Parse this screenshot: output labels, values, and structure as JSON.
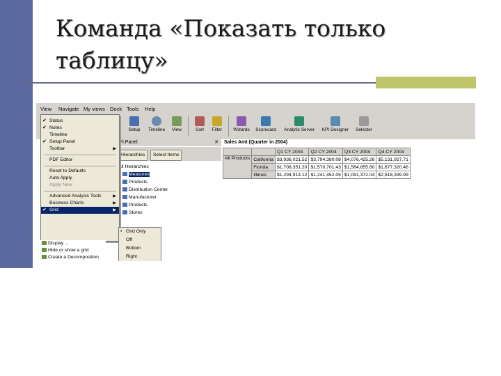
{
  "slide": {
    "title_line1": "Команда «Показать только",
    "title_line2": "таблицу»"
  },
  "menubar": [
    "View",
    "Navigate",
    "My views",
    "Dock",
    "Tools",
    "Help"
  ],
  "toolbar": {
    "buttons": [
      "Setup",
      "Timeline",
      "View",
      "Sort",
      "Filter",
      "Wizards",
      "Scorecard",
      "Analytic Server",
      "KPI Designer",
      "Selector"
    ]
  },
  "view_menu": {
    "items": [
      {
        "label": "Status",
        "checked": true
      },
      {
        "label": "Notes",
        "checked": true
      },
      {
        "label": "Timeline",
        "checked": false
      },
      {
        "label": "Setup Panel",
        "checked": true
      },
      {
        "label": "Toolbar",
        "checked": false,
        "submenu": true
      },
      {
        "label": "PDF Editor",
        "checked": false
      },
      {
        "label": "Reset to Defaults",
        "checked": false
      },
      {
        "label": "Auto Apply",
        "checked": false
      },
      {
        "label": "Apply Now",
        "checked": false
      },
      {
        "label": "Advanced Analysis Tools",
        "checked": false,
        "submenu": true
      },
      {
        "label": "Business Charts",
        "checked": false,
        "submenu": true
      },
      {
        "label": "Grid",
        "checked": true,
        "submenu": true,
        "highlighted": true
      }
    ]
  },
  "grid_submenu": {
    "items": [
      "Grid Only",
      "Off",
      "Bottom",
      "Right"
    ],
    "selected": "Grid Only"
  },
  "panel": {
    "header": "Fi Panel",
    "tabs": [
      "Hierarchies",
      "Select Items"
    ],
    "tree": [
      "All Hierarchies",
      "Measures",
      "Products",
      "Distribution Center",
      "Manufacturer",
      "Products",
      "Stores"
    ],
    "selected": "Measures"
  },
  "lower_panel": {
    "items": [
      "Display ...",
      "Hide or show a grid",
      "Create a Decomposition"
    ]
  },
  "grid": {
    "title": "Sales Amt (Quarter in 2004)",
    "columns": [
      "Q1 CY 2004",
      "Q2 CY 2004",
      "Q3 CY 2004",
      "Q4 CY 2004"
    ],
    "row_header": "All Products",
    "rows": [
      {
        "label": "California",
        "values": [
          "$3,936,021.52",
          "$3,794,380.08",
          "$4,076,425.26",
          "$5,131,927.71"
        ]
      },
      {
        "label": "Florida",
        "values": [
          "$1,708,351.20",
          "$1,570,701.43",
          "$1,564,855.60",
          "$1,677,320.46"
        ]
      },
      {
        "label": "Illinois",
        "values": [
          "$1,294,914.12",
          "$1,241,452.05",
          "$1,091,372.04",
          "$2,518,339.99"
        ]
      }
    ]
  },
  "colors": {
    "slide_bar": "#5a6a9e",
    "title_rule": "#6a6a8a",
    "accent": "#bfc56a",
    "menu_highlight": "#0a246a"
  }
}
